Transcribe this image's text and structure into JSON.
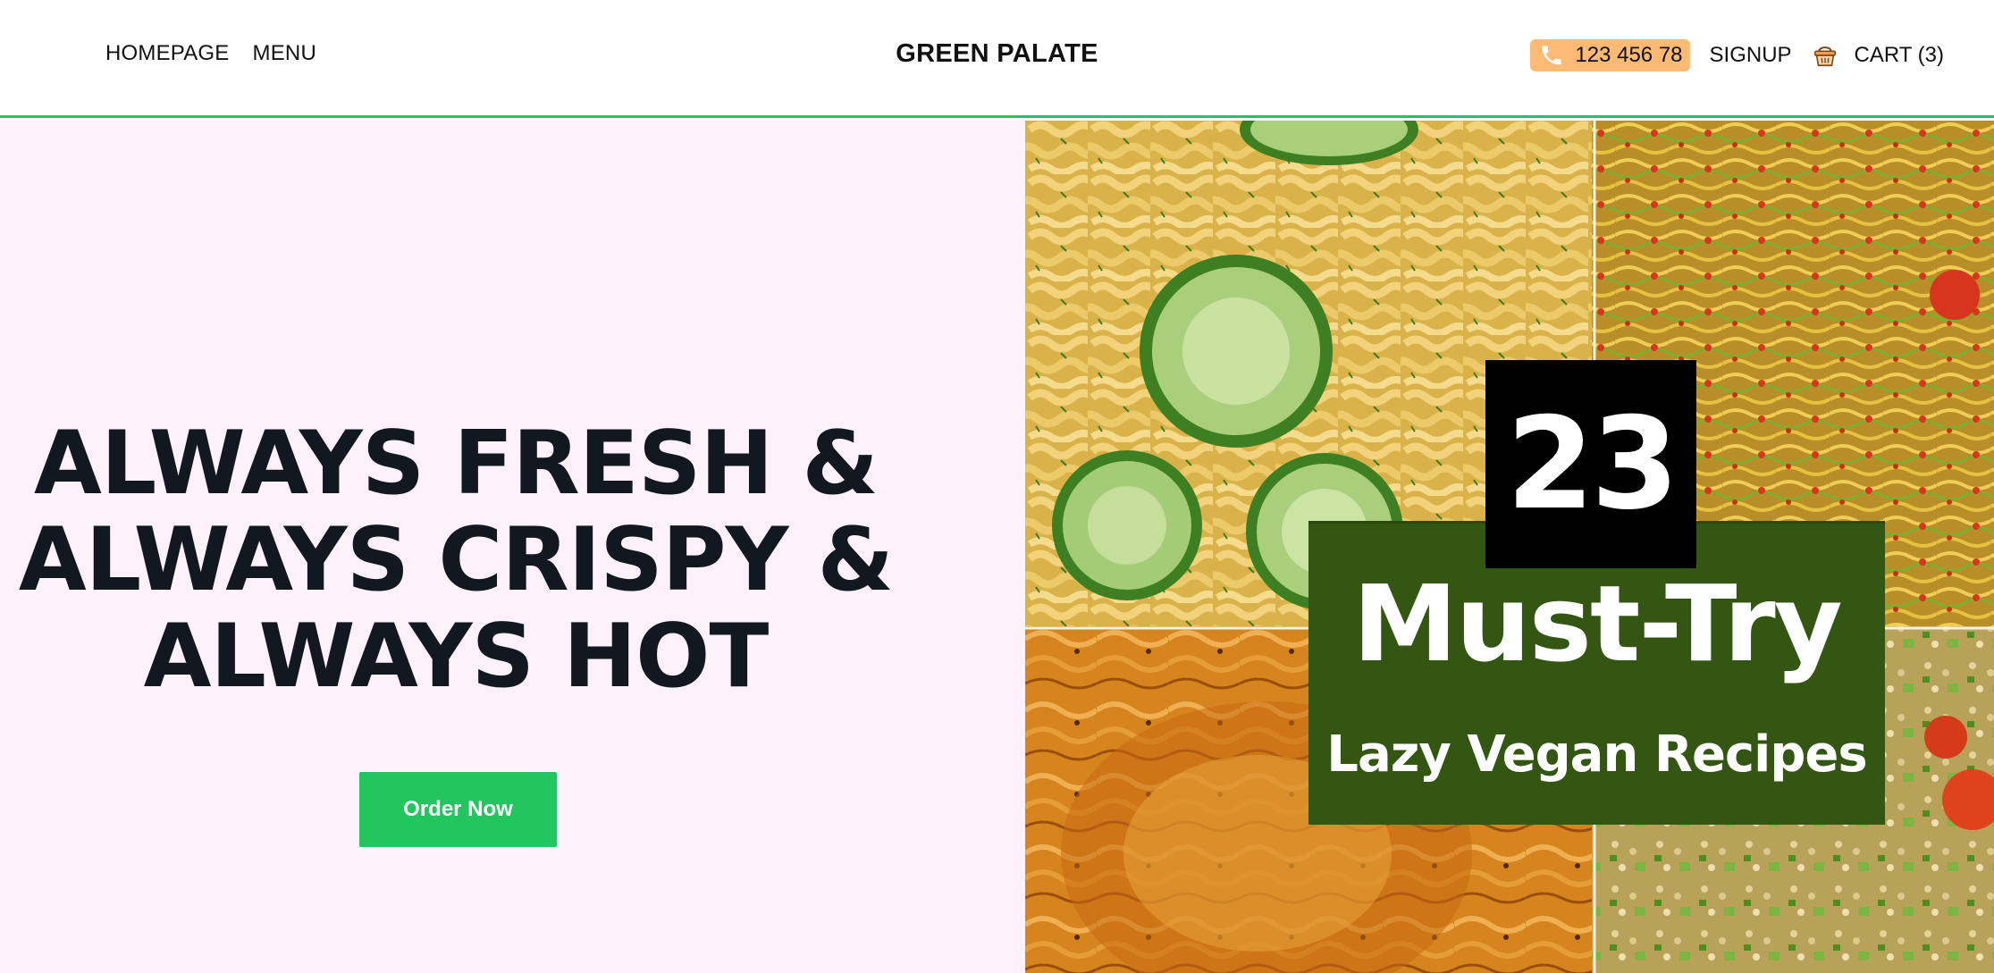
{
  "header": {
    "nav": [
      {
        "label": "HOMEPAGE"
      },
      {
        "label": "MENU"
      }
    ],
    "brand": "GREEN PALATE",
    "phone": "123 456 78",
    "signup": "SIGNUP",
    "cart": "CART (3)"
  },
  "hero": {
    "headline_lines": [
      "ALWAYS FRESH &",
      "ALWAYS CRISPY &",
      "ALWAYS HOT"
    ],
    "cta": "Order Now",
    "image": {
      "badge_number": "23",
      "badge_title": "Must-Try",
      "badge_subtitle": "Lazy Vegan Recipes"
    }
  },
  "colors": {
    "accent": "#22c55e",
    "phone_pill": "#fdba74",
    "hero_bg": "#fdf2fb",
    "headline": "#111820",
    "badge_green": "#345613"
  },
  "icons": [
    "phone-icon",
    "basket-icon"
  ]
}
